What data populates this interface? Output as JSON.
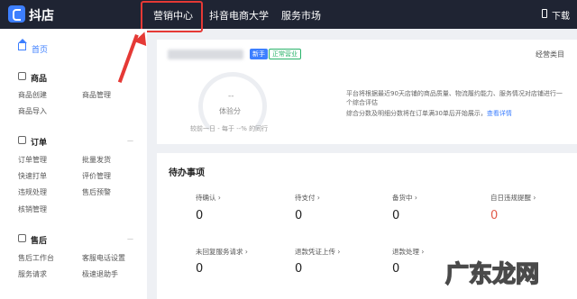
{
  "app": {
    "name": "抖店"
  },
  "nav": {
    "items": [
      "营销中心",
      "抖音电商大学",
      "服务市场"
    ],
    "download": "下载"
  },
  "sidebar": {
    "home": "首页",
    "sections": [
      {
        "title": "商品",
        "items": [
          "商品创建",
          "商品管理",
          "商品导入"
        ]
      },
      {
        "title": "订单",
        "items": [
          "订单管理",
          "批量发货",
          "快速打单",
          "评价管理",
          "违规处理",
          "售后预警",
          "核销管理"
        ]
      },
      {
        "title": "售后",
        "items": [
          "售后工作台",
          "客服电话设置",
          "服务请求",
          "极速退助手"
        ]
      }
    ]
  },
  "store": {
    "tag_new": "新手",
    "tag_status": "正常营业",
    "category": "经营类目",
    "score_value": "--",
    "score_label": "体验分",
    "compare": "较前一日 -    每于 --% 的同行",
    "desc_line1": "平台将根据最近90天店铺的商品质量、物流履约能力、服务情况对店铺进行一",
    "desc_line2": "个综合评估",
    "desc_line3": "综合分数及明细分数将在订单满30单后开始展示，",
    "desc_link": "查看详情"
  },
  "todo": {
    "title": "待办事项",
    "items": [
      {
        "label": "待确认 ›",
        "value": "0"
      },
      {
        "label": "待支付 ›",
        "value": "0"
      },
      {
        "label": "备货中 ›",
        "value": "0"
      },
      {
        "label": "自日违规提醒 ›",
        "value": "0"
      },
      {
        "label": "未回复服务请求 ›",
        "value": "0"
      },
      {
        "label": "退款凭证上传 ›",
        "value": "0"
      },
      {
        "label": "退款处理 ›",
        "value": "0"
      }
    ]
  },
  "watermark": "广东龙网",
  "colors": {
    "accent": "#3d7fff",
    "highlight": "#e53935",
    "topbar": "#1f2433",
    "warning_value": "#e25b4a"
  }
}
